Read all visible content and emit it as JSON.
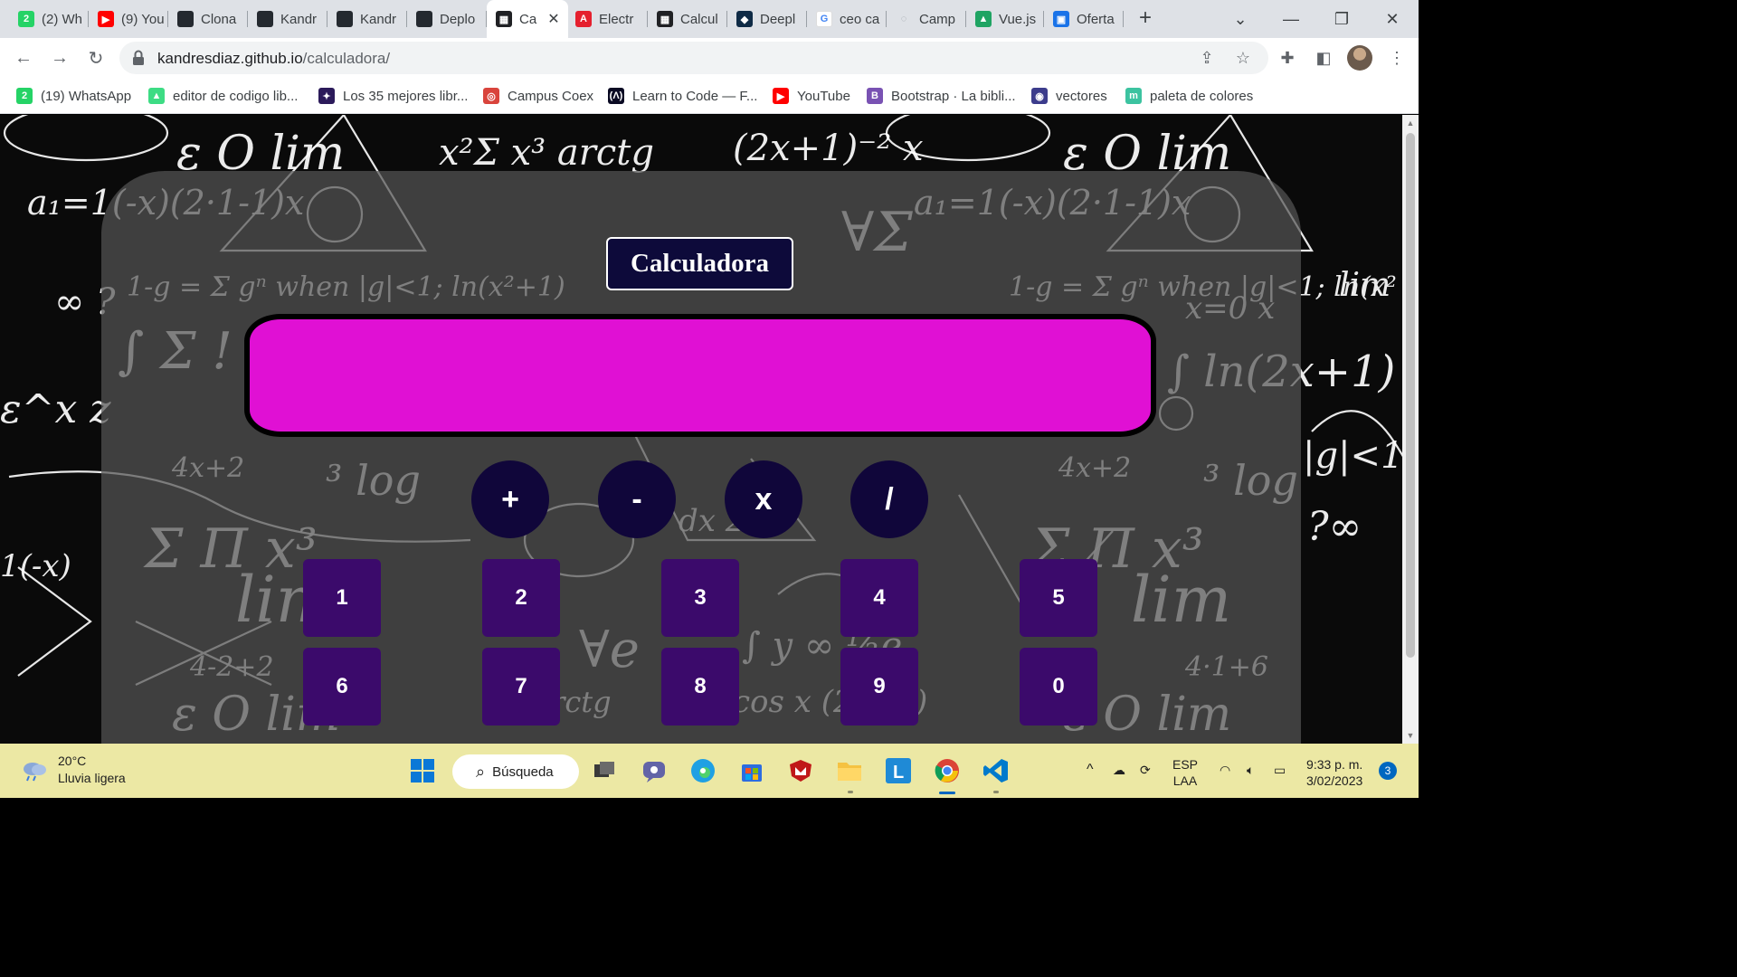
{
  "tabs": [
    {
      "label": "(2) Wh",
      "favicon": "whatsapp-icon",
      "color": "#25d366",
      "glyph": "2"
    },
    {
      "label": "(9) You",
      "favicon": "youtube-icon",
      "color": "#ff0000",
      "glyph": "▶"
    },
    {
      "label": "Clona",
      "favicon": "github-icon",
      "color": "#24292f",
      "glyph": ""
    },
    {
      "label": "Kandr",
      "favicon": "github-icon",
      "color": "#24292f",
      "glyph": ""
    },
    {
      "label": "Kandr",
      "favicon": "github-icon",
      "color": "#24292f",
      "glyph": ""
    },
    {
      "label": "Deplo",
      "favicon": "github-icon",
      "color": "#24292f",
      "glyph": ""
    },
    {
      "label": "Ca",
      "favicon": "calculator-icon",
      "color": "#202124",
      "glyph": "▦",
      "active": true
    },
    {
      "label": "Electr",
      "favicon": "adobe-acrobat-icon",
      "color": "#e5202e",
      "glyph": "A"
    },
    {
      "label": "Calcul",
      "favicon": "calculator-icon",
      "color": "#202124",
      "glyph": "▦"
    },
    {
      "label": "Deepl",
      "favicon": "deepl-icon",
      "color": "#0f2b46",
      "glyph": "◆"
    },
    {
      "label": "ceo ca",
      "favicon": "google-icon",
      "color": "#ffffff",
      "glyph": "G"
    },
    {
      "label": "Camp",
      "favicon": "loading-icon",
      "color": "#dee1e6",
      "glyph": "◌"
    },
    {
      "label": "Vue.js",
      "favicon": "google-drive-icon",
      "color": "#1fa463",
      "glyph": "▲"
    },
    {
      "label": "Oferta",
      "favicon": "job-search-icon",
      "color": "#1a73e8",
      "glyph": "▣"
    }
  ],
  "address": {
    "domain": "kandresdiaz.github.io",
    "path": "/calculadora/"
  },
  "bookmarks": [
    {
      "label": "(19) WhatsApp",
      "icon": "whatsapp-icon",
      "color": "#25d366",
      "glyph": "2"
    },
    {
      "label": "editor de codigo lib...",
      "icon": "android-icon",
      "color": "#3ddc84",
      "glyph": "▲"
    },
    {
      "label": "Los 35 mejores libr...",
      "icon": "book-icon",
      "color": "#2b1a5a",
      "glyph": "✦"
    },
    {
      "label": "Campus Coex",
      "icon": "coex-icon",
      "color": "#d9443c",
      "glyph": "◎"
    },
    {
      "label": "Learn to Code — F...",
      "icon": "freecodecamp-icon",
      "color": "#0a0a23",
      "glyph": "(Λ)"
    },
    {
      "label": "YouTube",
      "icon": "youtube-icon",
      "color": "#ff0000",
      "glyph": "▶"
    },
    {
      "label": "Bootstrap · La bibli...",
      "icon": "bootstrap-icon",
      "color": "#7952b3",
      "glyph": "B"
    },
    {
      "label": "vectores",
      "icon": "vectores-icon",
      "color": "#3c3c8c",
      "glyph": "◉"
    },
    {
      "label": "paleta de colores",
      "icon": "palette-icon",
      "color": "#3cc3a0",
      "glyph": "m"
    }
  ],
  "calculator": {
    "title": "Calculadora",
    "display_value": "",
    "operators": [
      "+",
      "-",
      "x",
      "/"
    ],
    "digits_row1": [
      "1",
      "2",
      "3",
      "4",
      "5"
    ],
    "digits_row2": [
      "6",
      "7",
      "8",
      "9",
      "0"
    ],
    "display_color": "#e010d4",
    "operator_color": "#10063a",
    "digit_color": "#3b0a6b"
  },
  "taskbar": {
    "temperature": "20°C",
    "weather_text": "Lluvia ligera",
    "search_label": "Búsqueda",
    "language_top": "ESP",
    "language_bottom": "LAA",
    "time": "9:33 p. m.",
    "date": "3/02/2023",
    "notification_count": "3"
  }
}
